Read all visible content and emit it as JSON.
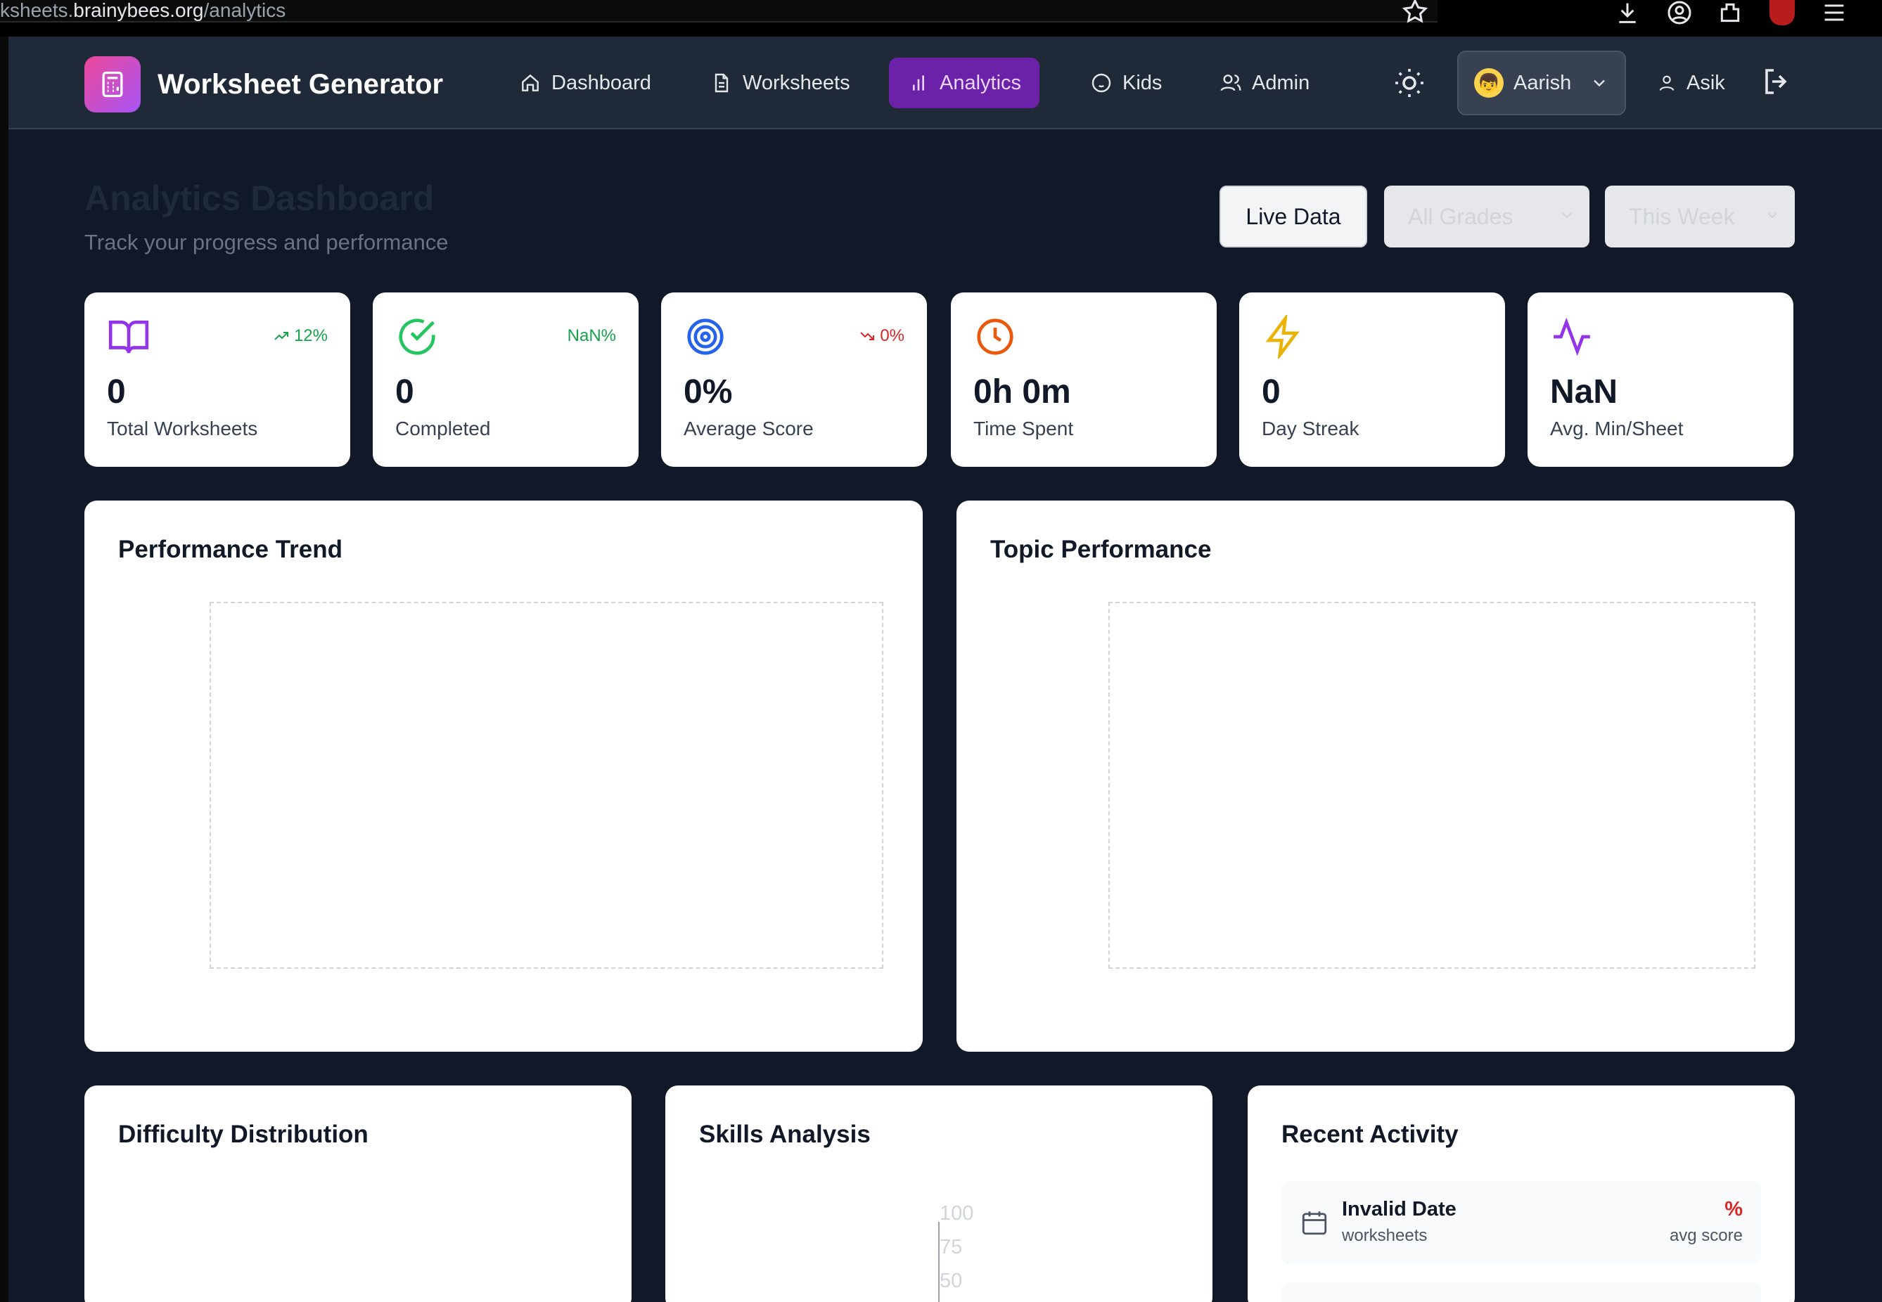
{
  "browser": {
    "url_prefix": "ksheets.",
    "url_host": "brainybees.org",
    "url_path": "/analytics",
    "icons": [
      "star-icon",
      "download-icon",
      "account-icon",
      "extensions-icon",
      "ublock-icon",
      "menu-icon"
    ]
  },
  "nav": {
    "brand": "Worksheet Generator",
    "items": [
      {
        "label": "Dashboard",
        "icon": "home-icon"
      },
      {
        "label": "Worksheets",
        "icon": "document-icon"
      },
      {
        "label": "Analytics",
        "icon": "bar-chart-icon",
        "active": true
      },
      {
        "label": "Kids",
        "icon": "baby-icon"
      },
      {
        "label": "Admin",
        "icon": "users-icon"
      }
    ],
    "theme_icon": "sun-icon",
    "kid_selector": {
      "avatar": "👦",
      "name": "Aarish"
    },
    "user": "Asik",
    "logout_icon": "logout-icon",
    "active_color": "#6b21a8"
  },
  "header": {
    "title": "Analytics Dashboard",
    "subtitle": "Track your progress and performance",
    "live_button": "Live Data",
    "grade_select": "All Grades",
    "period_select": "This Week"
  },
  "stats": [
    {
      "value": "0",
      "label": "Total Worksheets",
      "icon": "book-icon",
      "icon_color": "#9333ea",
      "trend": "12%",
      "trend_dir": "up",
      "trend_color": "#16a34a"
    },
    {
      "value": "0",
      "label": "Completed",
      "icon": "check-circle-icon",
      "icon_color": "#22c55e",
      "trend": "NaN%",
      "trend_dir": "none",
      "trend_color": "#16a34a"
    },
    {
      "value": "0%",
      "label": "Average Score",
      "icon": "target-icon",
      "icon_color": "#2563eb",
      "trend": "0%",
      "trend_dir": "down",
      "trend_color": "#dc2626"
    },
    {
      "value": "0h 0m",
      "label": "Time Spent",
      "icon": "clock-icon",
      "icon_color": "#ea580c",
      "trend": "",
      "trend_dir": "none",
      "trend_color": ""
    },
    {
      "value": "0",
      "label": "Day Streak",
      "icon": "zap-icon",
      "icon_color": "#eab308",
      "trend": "",
      "trend_dir": "none",
      "trend_color": ""
    },
    {
      "value": "NaN",
      "label": "Avg. Min/Sheet",
      "icon": "activity-icon",
      "icon_color": "#9333ea",
      "trend": "",
      "trend_dir": "none",
      "trend_color": ""
    }
  ],
  "panels": {
    "performance_trend": "Performance Trend",
    "topic_performance": "Topic Performance",
    "difficulty_distribution": "Difficulty Distribution",
    "skills_analysis": "Skills Analysis",
    "recent_activity": "Recent Activity"
  },
  "skills_axis_ticks": [
    "100",
    "75",
    "50"
  ],
  "recent_activity": [
    {
      "date": "Invalid Date",
      "sub": "worksheets",
      "pct": "%",
      "avg_label": "avg score"
    }
  ]
}
